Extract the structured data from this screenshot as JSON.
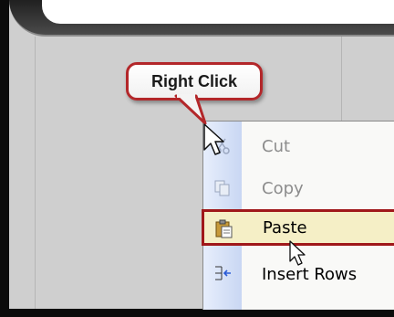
{
  "callout": {
    "text": "Right Click"
  },
  "context_menu": {
    "items": [
      {
        "label": "Cut",
        "state": "disabled",
        "icon": "scissors-icon"
      },
      {
        "label": "Copy",
        "state": "disabled",
        "icon": "copy-icon"
      },
      {
        "label": "Paste",
        "state": "highlighted",
        "icon": "clipboard-icon"
      },
      {
        "label": "Insert Rows",
        "state": "enabled",
        "icon": "insert-rows-icon"
      }
    ]
  },
  "colors": {
    "highlight_border": "#a0181a",
    "highlight_fill": "#f5efc6",
    "callout_border": "#b3272a",
    "menu_gutter": "#c9d7f3"
  }
}
